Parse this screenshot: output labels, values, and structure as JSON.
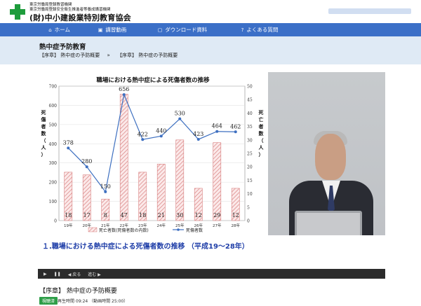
{
  "header": {
    "org_line1": "東京労働局登録教習機関",
    "org_line2": "東京労働局登録安全衛生推進者等養成講習機関",
    "org_name": "(財)中小建設業特別教育協会"
  },
  "nav": [
    {
      "icon": "home-icon",
      "glyph": "⌂",
      "label": "ホーム"
    },
    {
      "icon": "video-icon",
      "glyph": "▣",
      "label": "講習動画"
    },
    {
      "icon": "document-icon",
      "glyph": "▢",
      "label": "ダウンロード資料"
    },
    {
      "icon": "question-icon",
      "glyph": "?",
      "label": "よくある質問"
    }
  ],
  "page": {
    "title": "熱中症予防教育",
    "breadcrumb": [
      "【序章】 熱中症の予防概要",
      "»",
      "【序章】 熱中症の予防概要"
    ]
  },
  "video": {
    "caption": "１.職場における熱中症による死傷者数の推移 （平成19～28年）",
    "controls": {
      "back_label": "◀ 戻る",
      "forward_label": "進む ▶"
    }
  },
  "chart_data": {
    "type": "bar",
    "title": "職場における熱中症による死傷者数の推移",
    "ylabel": "死傷者数（人）",
    "y2label": "死亡者数（人）",
    "categories": [
      "19年",
      "20年",
      "21年",
      "22年",
      "23年",
      "24年",
      "25年",
      "26年",
      "27年",
      "28年"
    ],
    "ylim": [
      0,
      700
    ],
    "y2lim": [
      0,
      50
    ],
    "yticks": [
      0,
      100,
      200,
      300,
      400,
      500,
      600,
      700
    ],
    "y2ticks": [
      0,
      5,
      10,
      15,
      20,
      25,
      30,
      35,
      40,
      45,
      50
    ],
    "series": [
      {
        "name": "死亡者数(死傷者数の内数)",
        "kind": "bar",
        "axis": "y2",
        "values": [
          18,
          17,
          8,
          47,
          18,
          21,
          30,
          12,
          29,
          12
        ]
      },
      {
        "name": "死傷者数",
        "kind": "line",
        "axis": "y",
        "values": [
          378,
          280,
          150,
          656,
          422,
          440,
          530,
          423,
          464,
          462
        ]
      }
    ],
    "legend": "bottom"
  },
  "lesson": {
    "title": "【序章】 熱中症の予防概要",
    "badge": "視聴済",
    "play_info": "再生時間 09:24 （動画時間 25:00）"
  },
  "colors": {
    "nav": "#3b6fc7",
    "crumb_bg": "#dfeaf5",
    "bar": "#d98080",
    "line": "#3d6fc0",
    "caption": "#1f3ea8",
    "badge": "#2e9e48"
  }
}
